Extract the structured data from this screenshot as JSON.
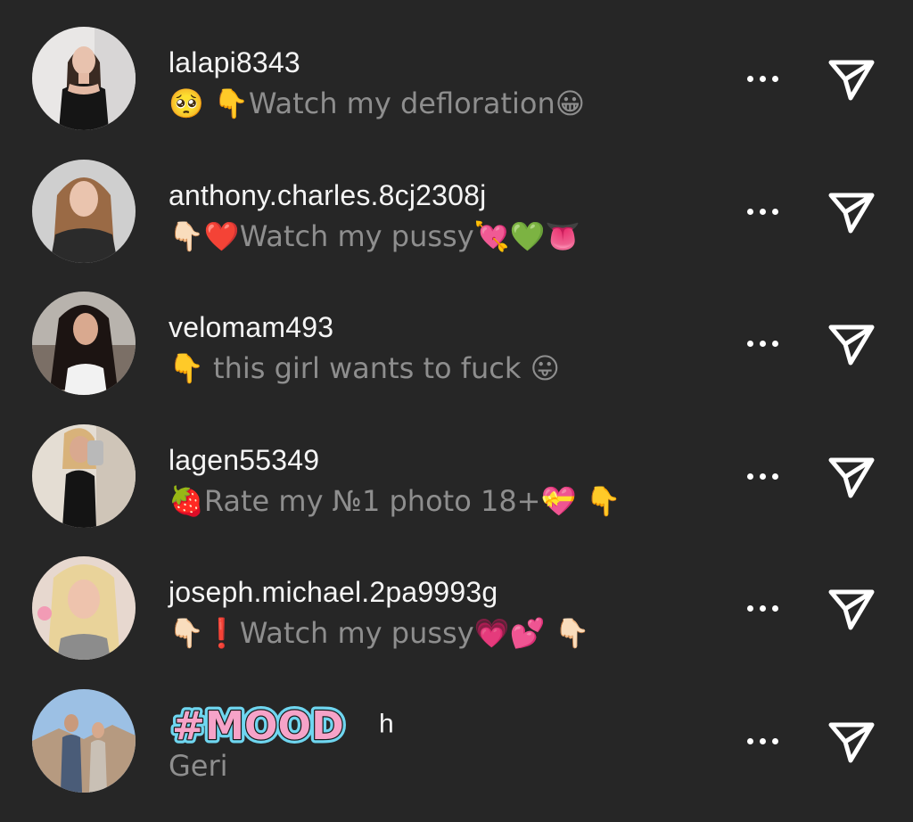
{
  "rows": [
    {
      "username": "lalapi8343",
      "message": "🥺 👇Watch my defloration😀"
    },
    {
      "username": "anthony.charles.8cj2308j",
      "message": "👇🏻❤️Watch my pussy💘💚👅"
    },
    {
      "username": "velomam493",
      "message": "👇 this girl wants to fuck 😛"
    },
    {
      "username": "lagen55349",
      "message": "🍓Rate my №1 photo 18+💝 👇"
    },
    {
      "username": "joseph.michael.2pa9993g",
      "message": "👇🏻❗Watch my pussy💗💕 👇🏻"
    },
    {
      "username_sticker": "#MOOD",
      "username_suffix": "h",
      "message": "Geri"
    }
  ],
  "icons": {
    "more": "more-horizontal-icon",
    "send": "send-paper-plane-icon"
  },
  "colors": {
    "background": "#262626",
    "username": "#f5f5f5",
    "message": "#8e8e8e",
    "sticker_fill": "#f6a3c8",
    "sticker_outline": "#6fd6f0"
  }
}
